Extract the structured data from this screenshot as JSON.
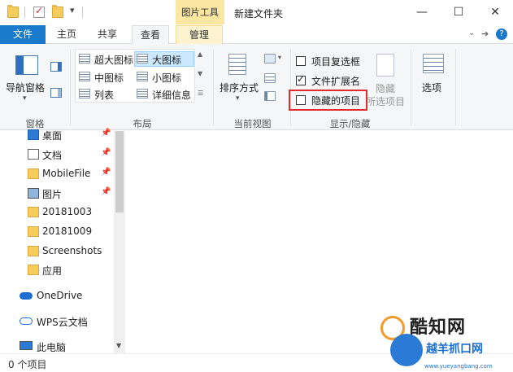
{
  "titlebar": {
    "context_tab": "图片工具",
    "window_title": "新建文件夹",
    "minimize": "—",
    "maximize": "☐",
    "close": "✕"
  },
  "tabs": {
    "file": "文件",
    "home": "主页",
    "share": "共享",
    "view": "查看",
    "manage": "管理",
    "help": "?"
  },
  "ribbon": {
    "panes": {
      "nav_pane": "导航窗格",
      "group_label": "窗格"
    },
    "layout": {
      "extra_large": "超大图标",
      "large": "大图标",
      "medium": "中图标",
      "small": "小图标",
      "list": "列表",
      "details": "详细信息",
      "group_label": "布局"
    },
    "current_view": {
      "sort_by": "排序方式",
      "group_label": "当前视图"
    },
    "show_hide": {
      "item_checkboxes": "项目复选框",
      "file_extensions": "文件扩展名",
      "hidden_items": "隐藏的项目",
      "hide_selected_line1": "隐藏",
      "hide_selected_line2": "所选项目",
      "group_label": "显示/隐藏",
      "item_checkboxes_checked": false,
      "file_extensions_checked": true,
      "hidden_items_checked": false
    },
    "options": {
      "label": "选项"
    }
  },
  "nav": {
    "items": [
      {
        "label": "桌面",
        "icon": "desktop-icon",
        "pinned": true
      },
      {
        "label": "文档",
        "icon": "document-icon",
        "pinned": true
      },
      {
        "label": "MobileFile",
        "icon": "folder-icon",
        "pinned": true
      },
      {
        "label": "图片",
        "icon": "picture-icon",
        "pinned": true
      },
      {
        "label": "20181003",
        "icon": "folder-icon",
        "pinned": false
      },
      {
        "label": "20181009",
        "icon": "folder-icon",
        "pinned": false
      },
      {
        "label": "Screenshots",
        "icon": "folder-icon",
        "pinned": false
      },
      {
        "label": "应用",
        "icon": "folder-icon",
        "pinned": false
      },
      {
        "label": "OneDrive",
        "icon": "cloud-icon",
        "pinned": false
      },
      {
        "label": "WPS云文档",
        "icon": "wps-cloud-icon",
        "pinned": false
      },
      {
        "label": "此电脑",
        "icon": "computer-icon",
        "pinned": false
      }
    ]
  },
  "status": {
    "count": "0 个项目"
  },
  "watermark": {
    "brand": "酷知网",
    "sub_brand": "越羊抓口网",
    "url": "www.yueyangbang.com"
  },
  "colors": {
    "file_tab": "#1979ca",
    "context_tab": "#fbe7a2",
    "highlight": "#e52c2c"
  }
}
